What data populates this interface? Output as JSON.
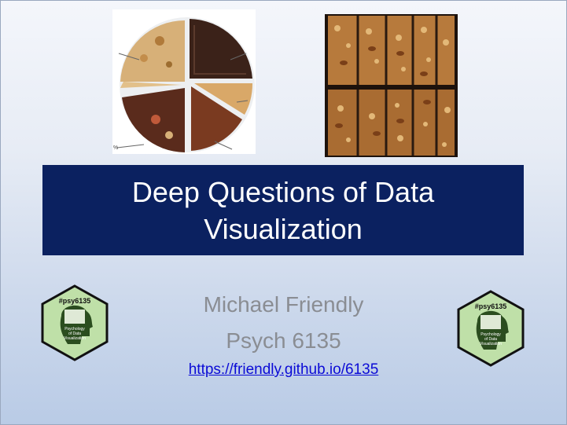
{
  "slide": {
    "title": "Deep Questions of Data Visualization",
    "author": "Michael Friendly",
    "course": "Psych 6135",
    "url": "https://friendly.github.io/6135"
  },
  "logo": {
    "hashtag": "#psy6135",
    "line1": "Psychology",
    "line2": "of Data",
    "line3": "Visualization"
  },
  "images": {
    "left": "pie-chart-made-of-cookies-icon",
    "right": "granola-bars-photo-icon"
  },
  "colors": {
    "title_bg": "#0b2160",
    "title_text": "#ffffff",
    "author_text": "#8a8d93",
    "link": "#0b0bd6",
    "logo_green": "#bfe0a8",
    "logo_dark": "#2b4d1f"
  }
}
